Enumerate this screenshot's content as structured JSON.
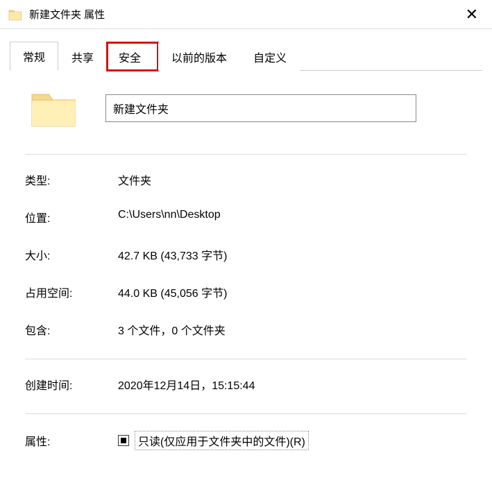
{
  "window": {
    "title": "新建文件夹 属性"
  },
  "tabs": {
    "t0": "常规",
    "t1": "共享",
    "t2": "安全",
    "t3": "以前的版本",
    "t4": "自定义"
  },
  "general": {
    "name": "新建文件夹",
    "type_label": "类型:",
    "type_value": "文件夹",
    "location_label": "位置:",
    "location_value": "C:\\Users\\nn\\Desktop",
    "size_label": "大小:",
    "size_value": "42.7 KB (43,733 字节)",
    "sizeondisk_label": "占用空间:",
    "sizeondisk_value": "44.0 KB (45,056 字节)",
    "contains_label": "包含:",
    "contains_value": "3 个文件，0 个文件夹",
    "created_label": "创建时间:",
    "created_value": "2020年12月14日，15:15:44",
    "attr_label": "属性:",
    "readonly_label": "只读(仅应用于文件夹中的文件)(R)"
  }
}
